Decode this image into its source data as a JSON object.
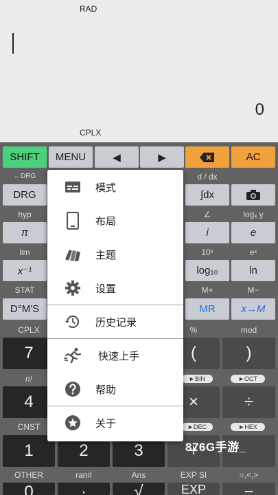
{
  "display": {
    "angle_mode": "RAD",
    "result": "0",
    "mode_indicator": "CPLX"
  },
  "top_row": {
    "shift": "SHIFT",
    "menu": "MENU",
    "left": "◀",
    "right": "▶",
    "backspace": "⌫",
    "ac": "AC"
  },
  "rows": {
    "r1": {
      "top": [
        "←DRG",
        "",
        "",
        "",
        "d / dx",
        ""
      ],
      "keys": [
        "DRG",
        "",
        "",
        "",
        "∫dx",
        "📷"
      ]
    },
    "r2": {
      "top": [
        "hyp",
        "",
        "",
        "",
        "∠",
        "logₓ y"
      ],
      "keys": [
        "π",
        "",
        "",
        "",
        "i",
        "e"
      ]
    },
    "r3": {
      "top": [
        "lim",
        "",
        "",
        "",
        "10ˣ",
        "eˣ"
      ],
      "keys": [
        "x⁻¹",
        "",
        "",
        "",
        "log₁₀",
        "ln"
      ]
    },
    "r4": {
      "top": [
        "STAT",
        "",
        "",
        "",
        "M+",
        "M−"
      ],
      "keys": [
        "D°M'S",
        "",
        "",
        "",
        "MR",
        "x→M"
      ]
    },
    "r5": {
      "top": [
        "CPLX",
        "",
        "",
        "",
        "%",
        "mod"
      ],
      "keys": [
        "7",
        "",
        "",
        "",
        "(",
        ")"
      ]
    },
    "r6": {
      "top": [
        "n!",
        "",
        "",
        "",
        "►BIN",
        "►OCT"
      ],
      "keys": [
        "4",
        "",
        "",
        "",
        "×",
        "÷"
      ]
    },
    "r7": {
      "top": [
        "CNST",
        "",
        "",
        "",
        "►DEC",
        "►HEX"
      ],
      "keys": [
        "1",
        "2",
        "3",
        "+",
        "",
        ""
      ]
    },
    "r8": {
      "top": [
        "OTHER",
        "ran#",
        "Ans",
        "EXP SI",
        "=,<,>"
      ],
      "keys": [
        "0",
        "·",
        "√",
        "EXP",
        "−"
      ]
    }
  },
  "menu": {
    "items": [
      {
        "label": "模式",
        "icon": "mode-icon"
      },
      {
        "label": "布局",
        "icon": "phone-icon"
      },
      {
        "label": "主题",
        "icon": "theme-icon"
      },
      {
        "label": "设置",
        "icon": "gear-icon"
      },
      {
        "label": "历史记录",
        "icon": "history-icon"
      },
      {
        "label": "快速上手",
        "icon": "running-icon"
      },
      {
        "label": "帮助",
        "icon": "help-icon"
      },
      {
        "label": "关于",
        "icon": "star-icon"
      }
    ]
  },
  "watermark": "876G手游_"
}
